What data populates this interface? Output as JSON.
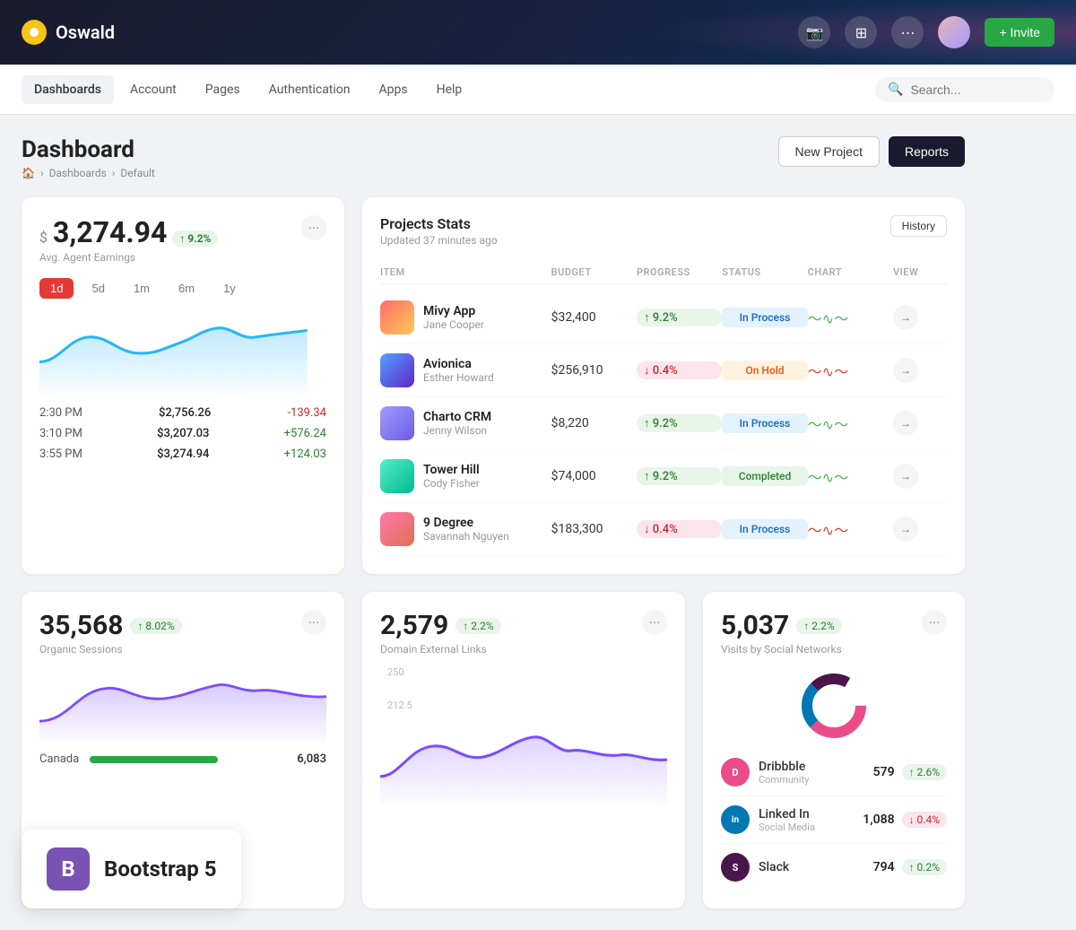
{
  "app": {
    "name": "Oswald"
  },
  "topnav": {
    "logo_label": "Oswald",
    "invite_label": "+ Invite"
  },
  "menubar": {
    "items": [
      {
        "label": "Dashboards",
        "active": true
      },
      {
        "label": "Account",
        "active": false
      },
      {
        "label": "Pages",
        "active": false
      },
      {
        "label": "Authentication",
        "active": false
      },
      {
        "label": "Apps",
        "active": false
      },
      {
        "label": "Help",
        "active": false
      }
    ],
    "search_placeholder": "Search..."
  },
  "page": {
    "title": "Dashboard",
    "breadcrumb": [
      "🏠",
      "Dashboards",
      "Default"
    ],
    "actions": {
      "new_project": "New Project",
      "reports": "Reports"
    }
  },
  "earnings_card": {
    "currency_symbol": "$",
    "amount": "3,274.94",
    "badge": "↑ 9.2%",
    "label": "Avg. Agent Earnings",
    "time_filters": [
      "1d",
      "5d",
      "1m",
      "6m",
      "1y"
    ],
    "active_filter": "1d",
    "rows": [
      {
        "time": "2:30 PM",
        "amount": "$2,756.26",
        "change": "-139.34",
        "positive": false
      },
      {
        "time": "3:10 PM",
        "amount": "$3,207.03",
        "change": "+576.24",
        "positive": true
      },
      {
        "time": "3:55 PM",
        "amount": "$3,274.94",
        "change": "+124.03",
        "positive": true
      }
    ]
  },
  "projects_card": {
    "title": "Projects Stats",
    "updated": "Updated 37 minutes ago",
    "history_label": "History",
    "columns": [
      "ITEM",
      "BUDGET",
      "PROGRESS",
      "STATUS",
      "CHART",
      "VIEW"
    ],
    "rows": [
      {
        "name": "Mivy App",
        "owner": "Jane Cooper",
        "budget": "$32,400",
        "progress": "↑ 9.2%",
        "progress_positive": true,
        "status": "In Process",
        "status_type": "inprocess",
        "color1": "#ff6b6b",
        "color2": "#feca57"
      },
      {
        "name": "Avionica",
        "owner": "Esther Howard",
        "budget": "$256,910",
        "progress": "↓ 0.4%",
        "progress_positive": false,
        "status": "On Hold",
        "status_type": "onhold",
        "color1": "#54a0ff",
        "color2": "#5f27cd"
      },
      {
        "name": "Charto CRM",
        "owner": "Jenny Wilson",
        "budget": "$8,220",
        "progress": "↑ 9.2%",
        "progress_positive": true,
        "status": "In Process",
        "status_type": "inprocess",
        "color1": "#a29bfe",
        "color2": "#6c5ce7"
      },
      {
        "name": "Tower Hill",
        "owner": "Cody Fisher",
        "budget": "$74,000",
        "progress": "↑ 9.2%",
        "progress_positive": true,
        "status": "Completed",
        "status_type": "completed",
        "color1": "#55efc4",
        "color2": "#00b894"
      },
      {
        "name": "9 Degree",
        "owner": "Savannah Nguyen",
        "budget": "$183,300",
        "progress": "↓ 0.4%",
        "progress_positive": false,
        "status": "In Process",
        "status_type": "inprocess",
        "color1": "#fd79a8",
        "color2": "#e17055"
      }
    ]
  },
  "organic_sessions": {
    "amount": "35,568",
    "badge": "↑ 8.02%",
    "label": "Organic Sessions",
    "countries": [
      {
        "name": "Canada",
        "value": 6083,
        "color": "#28a745",
        "width": 65
      }
    ]
  },
  "domain_links": {
    "amount": "2,579",
    "badge": "↑ 2.2%",
    "label": "Domain External Links"
  },
  "social_networks": {
    "amount": "5,037",
    "badge": "↑ 2.2%",
    "label": "Visits by Social Networks",
    "more_btn": "···",
    "rows": [
      {
        "name": "Dribbble",
        "sub": "Community",
        "count": "579",
        "badge": "↑ 2.6%",
        "positive": true,
        "bg": "#ea4c89",
        "letter": "D"
      },
      {
        "name": "Linked In",
        "sub": "Social Media",
        "count": "1,088",
        "badge": "↓ 0.4%",
        "positive": false,
        "bg": "#0077b5",
        "letter": "in"
      },
      {
        "name": "Slack",
        "sub": "",
        "count": "794",
        "badge": "↑ 0.2%",
        "positive": true,
        "bg": "#4a154b",
        "letter": "S"
      }
    ]
  },
  "bootstrap": {
    "label": "Bootstrap 5",
    "icon": "B"
  }
}
